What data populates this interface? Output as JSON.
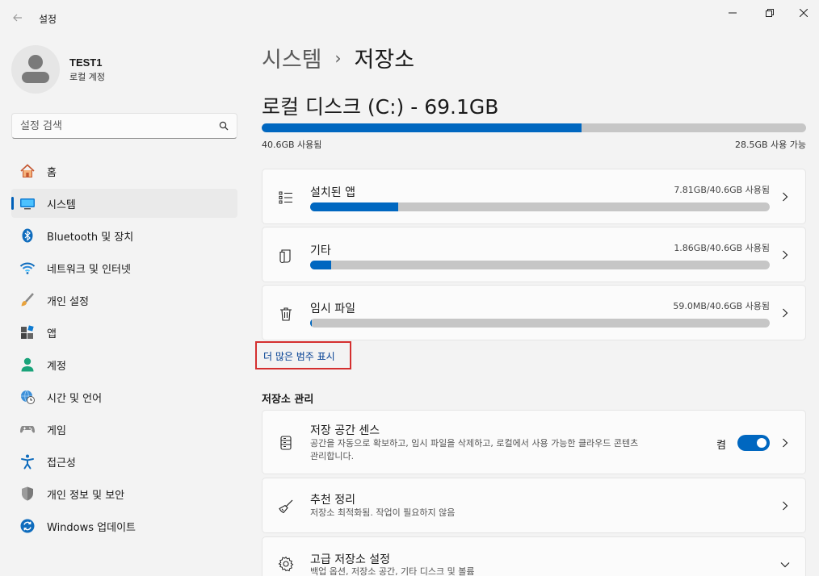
{
  "window": {
    "title": "설정"
  },
  "profile": {
    "name": "TEST1",
    "account_type": "로컬 계정"
  },
  "search": {
    "placeholder": "설정 검색"
  },
  "nav": {
    "items": [
      {
        "label": "홈",
        "icon": "home-icon"
      },
      {
        "label": "시스템",
        "icon": "system-icon",
        "active": true
      },
      {
        "label": "Bluetooth 및 장치",
        "icon": "bluetooth-icon"
      },
      {
        "label": "네트워크 및 인터넷",
        "icon": "wifi-icon"
      },
      {
        "label": "개인 설정",
        "icon": "brush-icon"
      },
      {
        "label": "앱",
        "icon": "apps-icon"
      },
      {
        "label": "계정",
        "icon": "account-icon"
      },
      {
        "label": "시간 및 언어",
        "icon": "globe-clock-icon"
      },
      {
        "label": "게임",
        "icon": "gamepad-icon"
      },
      {
        "label": "접근성",
        "icon": "accessibility-icon"
      },
      {
        "label": "개인 정보 및 보안",
        "icon": "shield-icon"
      },
      {
        "label": "Windows 업데이트",
        "icon": "update-icon"
      }
    ]
  },
  "breadcrumb": {
    "parent": "시스템",
    "separator": "›",
    "current": "저장소"
  },
  "disk": {
    "title": "로컬 디스크 (C:) - 69.1GB",
    "used_label": "40.6GB 사용됨",
    "free_label": "28.5GB 사용 가능",
    "used_fraction": 0.588
  },
  "categories": [
    {
      "title": "설치된 앱",
      "usage": "7.81GB/40.6GB 사용됨",
      "fraction": 0.192,
      "icon": "app-list-icon"
    },
    {
      "title": "기타",
      "usage": "1.86GB/40.6GB 사용됨",
      "fraction": 0.046,
      "icon": "document-icon"
    },
    {
      "title": "임시 파일",
      "usage": "59.0MB/40.6GB 사용됨",
      "fraction": 0.0015,
      "icon": "trash-icon"
    }
  ],
  "more_link": "더 많은 범주 표시",
  "management": {
    "section_title": "저장소 관리",
    "items": [
      {
        "title": "저장 공간 센스",
        "desc_line1": "공간을 자동으로 확보하고, 임시 파일을 삭제하고, 로컬에서 사용 가능한 클라우드 콘텐츠",
        "desc_line2": "관리합니다.",
        "toggle_label": "켬",
        "toggle_on": true,
        "icon": "storage-sense-icon"
      },
      {
        "title": "추천 정리",
        "desc_line1": "저장소 최적화됨. 작업이 필요하지 않음",
        "icon": "broom-icon"
      },
      {
        "title": "고급 저장소 설정",
        "desc_line1": "백업 옵션, 저장소 공간, 기타 디스크 및 볼륨",
        "icon": "gear-icon"
      }
    ]
  },
  "colors": {
    "accent": "#0067c0",
    "bar_track": "#c6c6c6",
    "highlight_box": "#d42f2f",
    "link": "#003e92"
  }
}
